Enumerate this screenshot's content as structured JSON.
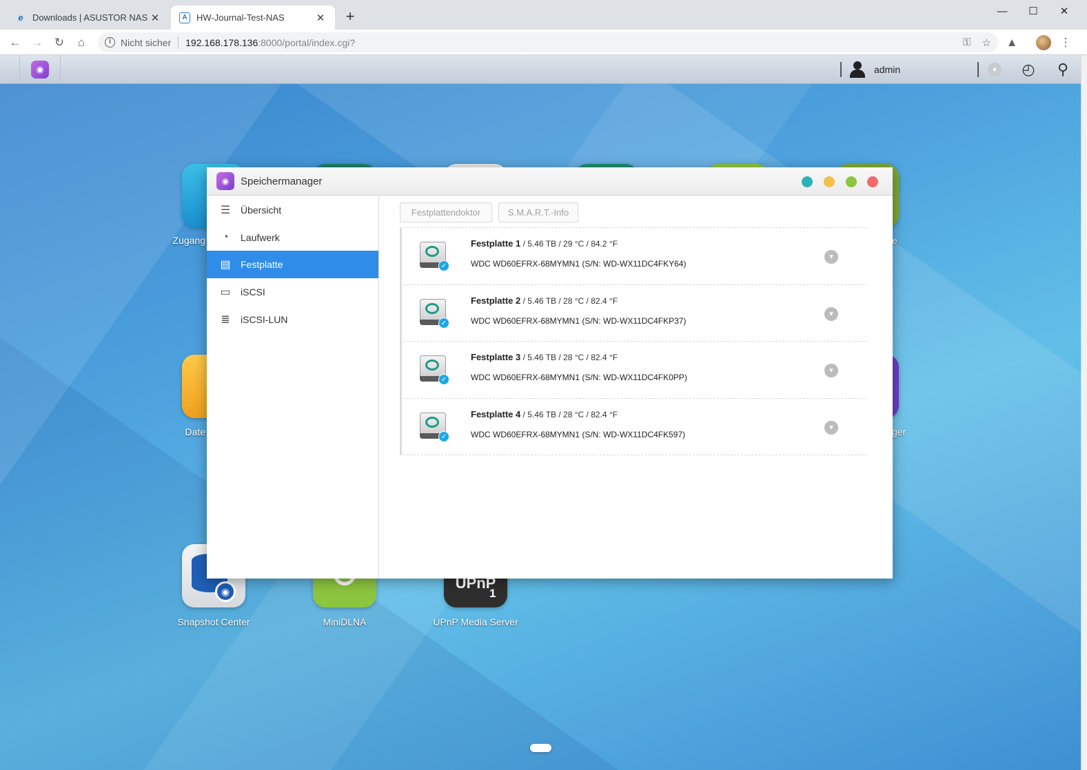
{
  "browser": {
    "tabs": [
      {
        "title": "Downloads | ASUSTOR NAS",
        "active": false
      },
      {
        "title": "HW-Journal-Test-NAS",
        "active": true
      }
    ],
    "security_label": "Nicht sicher",
    "url_host": "192.168.178.136",
    "url_path": ":8000/portal/index.cgi?"
  },
  "adm": {
    "username": "admin"
  },
  "desktop": {
    "icons": [
      {
        "label": "Zugang"
      },
      {
        "label": "Date"
      },
      {
        "label": "Snapshot Center"
      },
      {
        "label": "MiniDLNA"
      },
      {
        "label": "UPnP Media Server"
      },
      {
        "label": "e"
      },
      {
        "label": "ger"
      }
    ],
    "upnp_badge": "UPnP",
    "upnp_number": "1"
  },
  "window": {
    "title": "Speichermanager",
    "sidebar": [
      {
        "label": "Übersicht",
        "icon": "list-icon"
      },
      {
        "label": "Laufwerk",
        "icon": "volume-icon"
      },
      {
        "label": "Festplatte",
        "icon": "disk-icon",
        "active": true
      },
      {
        "label": "iSCSI",
        "icon": "iscsi-icon"
      },
      {
        "label": "iSCSI-LUN",
        "icon": "database-icon"
      }
    ],
    "toolbar": {
      "doctor_label": "Festplattendoktor",
      "smart_label": "S.M.A.R.T.-Info"
    },
    "disks": [
      {
        "name": "Festplatte 1",
        "spec": " / 5.46 TB / 29 °C / 84.2 °F",
        "model": "WDC WD60EFRX-68MYMN1 (S/N: WD-WX11DC4FKY64)"
      },
      {
        "name": "Festplatte 2",
        "spec": " / 5.46 TB / 28 °C / 82.4 °F",
        "model": "WDC WD60EFRX-68MYMN1 (S/N: WD-WX11DC4FKP37)"
      },
      {
        "name": "Festplatte 3",
        "spec": " / 5.46 TB / 28 °C / 82.4 °F",
        "model": "WDC WD60EFRX-68MYMN1 (S/N: WD-WX11DC4FK0PP)"
      },
      {
        "name": "Festplatte 4",
        "spec": " / 5.46 TB / 28 °C / 82.4 °F",
        "model": "WDC WD60EFRX-68MYMN1 (S/N: WD-WX11DC4FK597)"
      }
    ]
  },
  "colors": {
    "accent": "#2f8ce8",
    "dot_teal": "#2bb3b8",
    "dot_yellow": "#f4c04a",
    "dot_green": "#8cc63f",
    "dot_red": "#f16b6b"
  }
}
